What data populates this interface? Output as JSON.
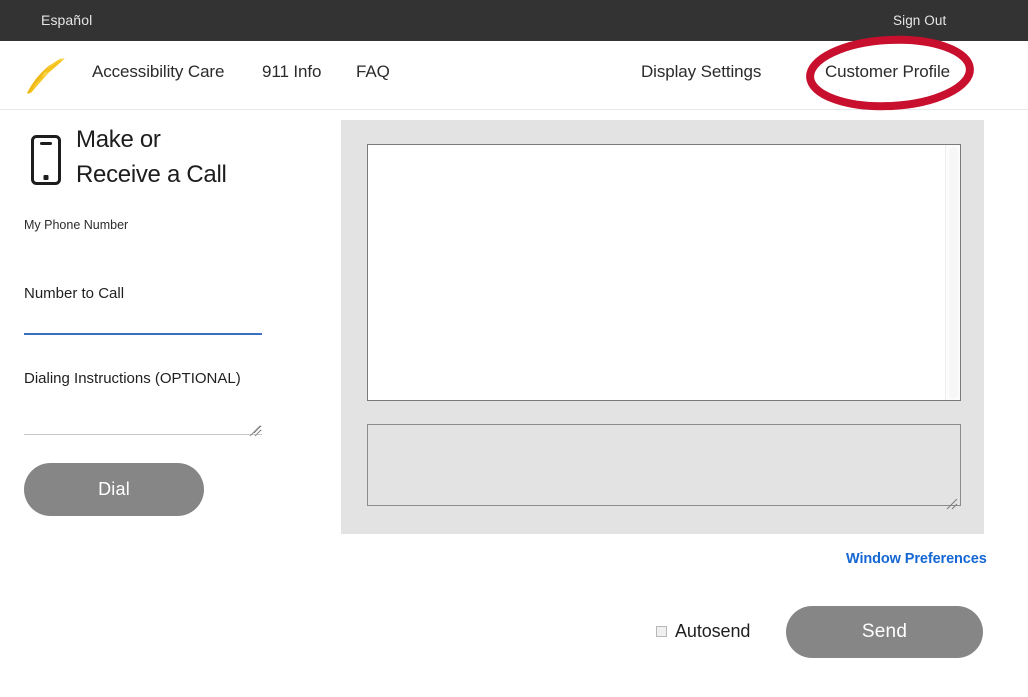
{
  "utility_bar": {
    "language_label": "Español",
    "sign_out_label": "Sign Out",
    "background_color": "#333333"
  },
  "header": {
    "logo_name": "sprint-wing-logo",
    "logo_color": "#f5c31a",
    "nav_items": [
      {
        "label": "Accessibility Care",
        "name": "nav-accessibility-care"
      },
      {
        "label": "911 Info",
        "name": "nav-911-info"
      },
      {
        "label": "FAQ",
        "name": "nav-faq"
      },
      {
        "label": "Display Settings",
        "name": "nav-display-settings"
      },
      {
        "label": "Customer Profile",
        "name": "nav-customer-profile"
      }
    ]
  },
  "annotation": {
    "target": "Customer Profile",
    "shape": "ellipse",
    "color": "#c8102e",
    "stroke_width": 8
  },
  "call_panel": {
    "icon_name": "smartphone-icon",
    "title_line_1": "Make or",
    "title_line_2": "Receive a Call",
    "my_phone_number": {
      "label": "My Phone Number",
      "value": ""
    },
    "number_to_call": {
      "label": "Number to Call",
      "value": "",
      "placeholder": "",
      "focused": true,
      "underline_color": "#3a6fc0"
    },
    "dialing_instructions": {
      "label": "Dialing Instructions (OPTIONAL)",
      "value": "",
      "placeholder": "",
      "underline_color": "#c6c6c6"
    },
    "dial_button_label": "Dial",
    "button_color": "#868686"
  },
  "conversation": {
    "transcript_text": "",
    "transcript_background": "#ffffff",
    "panel_background": "#e3e3e3",
    "compose_text": "",
    "compose_placeholder": ""
  },
  "controls": {
    "window_preferences_label": "Window Preferences",
    "window_preferences_color": "#1567d3",
    "autosend_label": "Autosend",
    "autosend_checked": false,
    "send_button_label": "Send"
  }
}
